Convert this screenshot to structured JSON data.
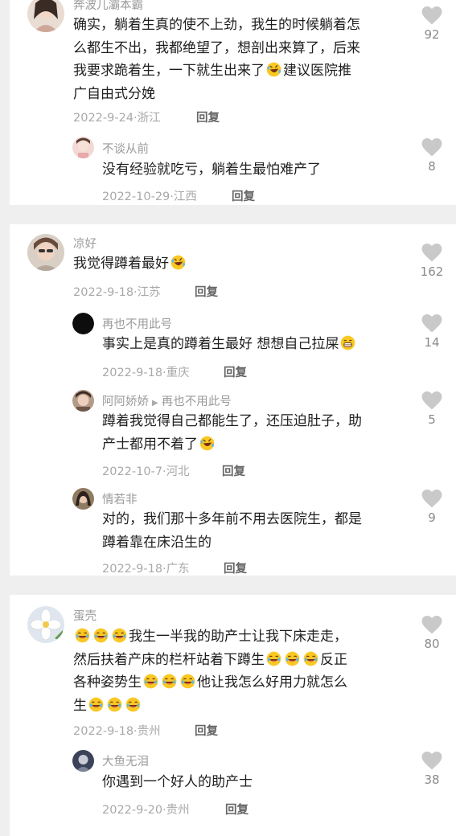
{
  "colors": {
    "page_bg": "#efefef",
    "card_bg": "#ffffff",
    "emoji_yellow": "#f9c823",
    "name_gray": "#9a9a9a"
  },
  "comments": [
    {
      "user": "奔波儿灞本霸",
      "lines": [
        "确实，躺着生真的使不上劲，我生的时候躺着怎",
        "么都生不出，我都绝望了，想剖出来算了，后来",
        "我要求跪着生，一下就生出来了",
        "广自由式分娩"
      ],
      "line3_tail": "建议医院推",
      "date": "2022-9-24·浙江",
      "reply": "回复",
      "likes": "92",
      "replies": [
        {
          "user": "不谈从前",
          "text": "没有经验就吃亏，躺着生最怕难产了",
          "date": "2022-10-29·江西",
          "reply": "回复",
          "likes": "8"
        }
      ]
    },
    {
      "user": "凉好",
      "text": "我觉得蹲着最好",
      "date": "2022-9-18·江苏",
      "reply": "回复",
      "likes": "162",
      "replies": [
        {
          "user": "再也不用此号",
          "text": "事实上是真的蹲着生最好 想想自己拉屎",
          "date": "2022-9-18·重庆",
          "reply": "回复",
          "likes": "14"
        },
        {
          "user": "阿阿娇娇",
          "reply_to": "再也不用此号",
          "lines": [
            "蹲着我觉得自己都能生了，还压迫肚子，助",
            "产士都用不着了"
          ],
          "date": "2022-10-7·河北",
          "reply": "回复",
          "likes": "5"
        },
        {
          "user": "情若非",
          "lines": [
            "对的，我们那十多年前不用去医院生，都是",
            "蹲着靠在床沿生的"
          ],
          "date": "2022-9-18·广东",
          "reply": "回复",
          "likes": "9"
        }
      ]
    },
    {
      "user": "蛋壳",
      "line1": "我生一半我的助产士让我下床走走，",
      "line2": "然后扶着产床的栏杆站着下蹲生",
      "line2_tail": "反正",
      "line3": "各种姿势生",
      "line3_tail": "他让我怎么好用力就怎么",
      "line4": "生",
      "date": "2022-9-18·贵州",
      "reply": "回复",
      "likes": "80",
      "replies": [
        {
          "user": "大鱼无泪",
          "text": "你遇到一个好人的助产士",
          "date": "2022-9-20·贵州",
          "reply": "回复",
          "likes": "38"
        }
      ]
    }
  ]
}
